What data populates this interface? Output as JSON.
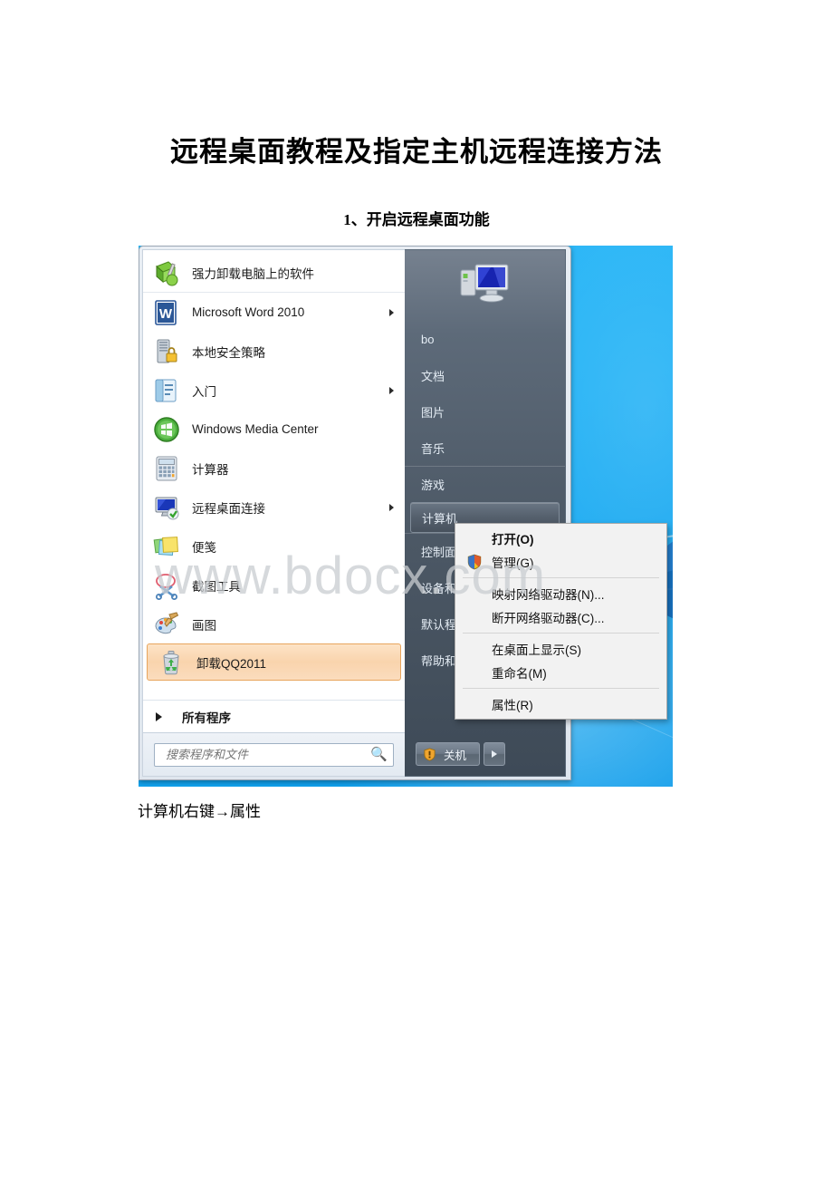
{
  "document": {
    "title": "远程桌面教程及指定主机远程连接方法",
    "subtitle": "1、开启远程桌面功能",
    "caption": "计算机右键→属性"
  },
  "watermark": "www.bdocx.com",
  "start_menu": {
    "programs": [
      {
        "label": "强力卸载电脑上的软件",
        "icon": "uninstall-tool-icon",
        "arrow": false,
        "separator_below": true,
        "highlight": false
      },
      {
        "label": "Microsoft Word 2010",
        "icon": "word-icon",
        "arrow": true,
        "separator_below": false,
        "highlight": false
      },
      {
        "label": "本地安全策略",
        "icon": "local-security-policy-icon",
        "arrow": false,
        "separator_below": false,
        "highlight": false
      },
      {
        "label": "入门",
        "icon": "getting-started-icon",
        "arrow": true,
        "separator_below": false,
        "highlight": false
      },
      {
        "label": "Windows Media Center",
        "icon": "media-center-icon",
        "arrow": false,
        "separator_below": false,
        "highlight": false
      },
      {
        "label": "计算器",
        "icon": "calculator-icon",
        "arrow": false,
        "separator_below": false,
        "highlight": false
      },
      {
        "label": "远程桌面连接",
        "icon": "remote-desktop-icon",
        "arrow": true,
        "separator_below": false,
        "highlight": false
      },
      {
        "label": "便笺",
        "icon": "sticky-notes-icon",
        "arrow": false,
        "separator_below": false,
        "highlight": false
      },
      {
        "label": "截图工具",
        "icon": "snipping-tool-icon",
        "arrow": false,
        "separator_below": false,
        "highlight": false
      },
      {
        "label": "画图",
        "icon": "paint-icon",
        "arrow": false,
        "separator_below": false,
        "highlight": false
      },
      {
        "label": "卸载QQ2011",
        "icon": "recycle-bin-icon",
        "arrow": false,
        "separator_below": false,
        "highlight": true
      }
    ],
    "all_programs_label": "所有程序",
    "search": {
      "placeholder": "搜索程序和文件",
      "value": "",
      "icon": "search-icon"
    },
    "user": {
      "name_item": "bo",
      "avatar_icon": "computer-monitor-avatar-icon"
    },
    "places": [
      {
        "label": "bo",
        "selected": false,
        "divider_above": false
      },
      {
        "label": "文档",
        "selected": false,
        "divider_above": false
      },
      {
        "label": "图片",
        "selected": false,
        "divider_above": false
      },
      {
        "label": "音乐",
        "selected": false,
        "divider_above": false
      },
      {
        "label": "游戏",
        "selected": false,
        "divider_above": true
      },
      {
        "label": "计算机",
        "selected": true,
        "divider_above": false
      },
      {
        "label": "控制面板",
        "selected": false,
        "divider_above": true
      },
      {
        "label": "设备和打印机",
        "selected": false,
        "divider_above": false
      },
      {
        "label": "默认程序",
        "selected": false,
        "divider_above": false
      },
      {
        "label": "帮助和支持",
        "selected": false,
        "divider_above": false
      }
    ],
    "shutdown": {
      "label": "关机",
      "shield_icon": "shutdown-shield-icon",
      "more_icon": "chevron-right-icon"
    }
  },
  "context_menu": {
    "items": [
      {
        "label": "打开(O)",
        "bold": true,
        "icon": null,
        "separator_after": false
      },
      {
        "label": "管理(G)",
        "bold": false,
        "icon": "uac-shield-icon",
        "separator_after": true
      },
      {
        "label": "映射网络驱动器(N)...",
        "bold": false,
        "icon": null,
        "separator_after": false
      },
      {
        "label": "断开网络驱动器(C)...",
        "bold": false,
        "icon": null,
        "separator_after": true
      },
      {
        "label": "在桌面上显示(S)",
        "bold": false,
        "icon": null,
        "separator_after": false
      },
      {
        "label": "重命名(M)",
        "bold": false,
        "icon": null,
        "separator_after": true
      },
      {
        "label": "属性(R)",
        "bold": false,
        "icon": null,
        "separator_after": false
      }
    ]
  },
  "colors": {
    "highlight_orange": "#f9d4ad",
    "desktop_blue": "#19b0f5",
    "panel_dark": "#4c5865",
    "accent_link": "#2c6fb5"
  }
}
